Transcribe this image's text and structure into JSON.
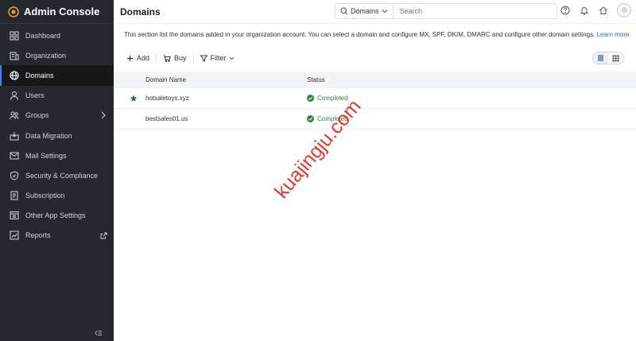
{
  "app": {
    "title": "Admin Console"
  },
  "sidebar": {
    "items": [
      {
        "label": "Dashboard",
        "icon": "dashboard-icon"
      },
      {
        "label": "Organization",
        "icon": "organization-icon"
      },
      {
        "label": "Domains",
        "icon": "globe-icon",
        "active": true
      },
      {
        "label": "Users",
        "icon": "user-icon"
      },
      {
        "label": "Groups",
        "icon": "groups-icon",
        "trailing": "chevron-right-icon"
      },
      {
        "label": "Data Migration",
        "icon": "data-migration-icon"
      },
      {
        "label": "Mail Settings",
        "icon": "mail-settings-icon"
      },
      {
        "label": "Security & Compliance",
        "icon": "shield-icon"
      },
      {
        "label": "Subscription",
        "icon": "subscription-icon"
      },
      {
        "label": "Other App Settings",
        "icon": "app-settings-icon"
      },
      {
        "label": "Reports",
        "icon": "reports-icon",
        "trailing": "external-link-icon"
      }
    ],
    "collapse_icon": "collapse-sidebar-icon"
  },
  "header": {
    "title": "Domains",
    "search": {
      "scope": "Domains",
      "placeholder": "Search"
    },
    "icons": [
      "help-icon",
      "bell-icon",
      "home-icon",
      "avatar"
    ]
  },
  "main": {
    "description": "This section list the domains added in your organization account. You can select a domain and configure MX, SPF, DKIM, DMARC and configure other domain settings.",
    "learn_more": "Learn more",
    "toolbar": {
      "add": "Add",
      "buy": "Buy",
      "filter": "Filter"
    },
    "view": {
      "selected": "list-view"
    },
    "table": {
      "columns": [
        "Domain Name",
        "Status"
      ],
      "rows": [
        {
          "starred": true,
          "domain": "hotsaletoys.xyz",
          "status": "Completed"
        },
        {
          "starred": false,
          "domain": "bestsales01.us",
          "status": "Completed"
        }
      ]
    }
  },
  "watermark": "kuajingju.com",
  "colors": {
    "sidebar_bg": "#25282e",
    "accent": "#2f6fd6",
    "success": "#2a8a36",
    "star": "#1f7a2e",
    "watermark": "#e32f27"
  }
}
